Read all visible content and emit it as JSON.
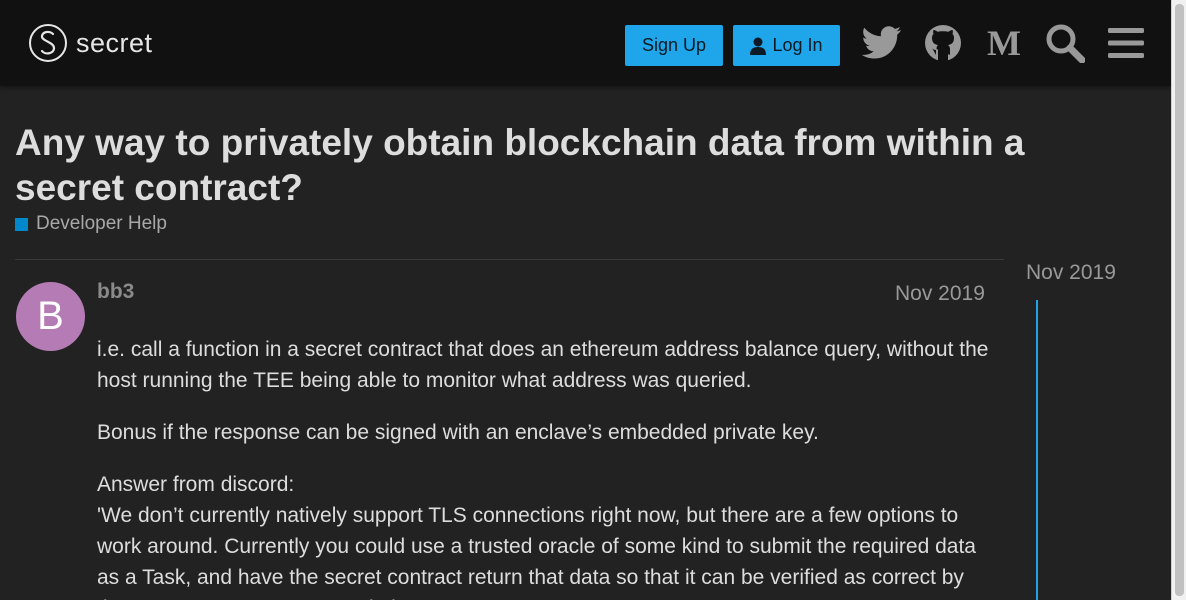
{
  "header": {
    "logo_text": "secret",
    "signup_label": "Sign Up",
    "login_label": "Log In"
  },
  "topic": {
    "title": "Any way to privately obtain blockchain data from within a secret contract?",
    "category": "Developer Help",
    "category_color": "#0088cc"
  },
  "post": {
    "avatar_letter": "B",
    "avatar_color": "#b57bb5",
    "username": "bb3",
    "date": "Nov 2019",
    "paragraphs": [
      "i.e. call a function in a secret contract that does an ethereum address balance query, without the host running the TEE being able to monitor what address was queried.",
      "Bonus if the response can be signed with an enclave’s embedded private key."
    ],
    "answer_label": "Answer from discord:",
    "answer_text": "'We don’t currently natively support TLS connections right now, but there are a few options to work around. Currently you could use a trusted oracle of some kind to submit the required data as a Task, and have the secret contract return that data so that it can be verified as correct by the secret contract... more solutions"
  },
  "timeline": {
    "date": "Nov 2019"
  },
  "colors": {
    "accent": "#1fa5ea",
    "background": "#222222",
    "header": "#111111"
  },
  "icons": [
    "twitter-icon",
    "github-icon",
    "medium-icon",
    "search-icon",
    "hamburger-menu-icon"
  ]
}
